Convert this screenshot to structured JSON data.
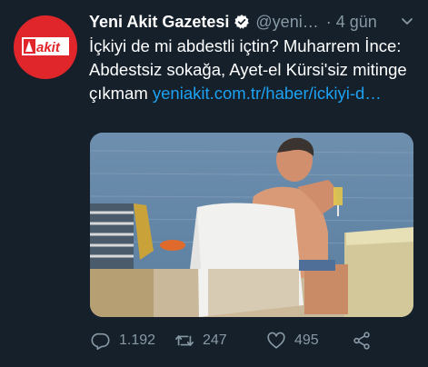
{
  "tweet": {
    "author_name": "Yeni Akit Gazetesi",
    "handle": "@yeni…",
    "separator": "·",
    "time": "4 gün",
    "text": "İçkiyi de mi abdestli içtin? Muharrem İnce: Abdestsiz sokağa, Ayet-el Kürsi'siz mitinge çıkmam ",
    "link_text": "yeniakit.com.tr/haber/ickiyi-d…",
    "avatar_logo_text": "akit"
  },
  "actions": {
    "reply_count": "1.192",
    "retweet_count": "247",
    "like_count": "495"
  },
  "icons": {
    "verified": "verified-badge-icon",
    "menu": "chevron-down-icon",
    "reply": "reply-icon",
    "retweet": "retweet-icon",
    "like": "heart-icon",
    "share": "share-icon"
  },
  "colors": {
    "background": "#15202b",
    "secondary_text": "#8899a6",
    "link": "#1da1f2",
    "avatar_red": "#e0262b"
  }
}
